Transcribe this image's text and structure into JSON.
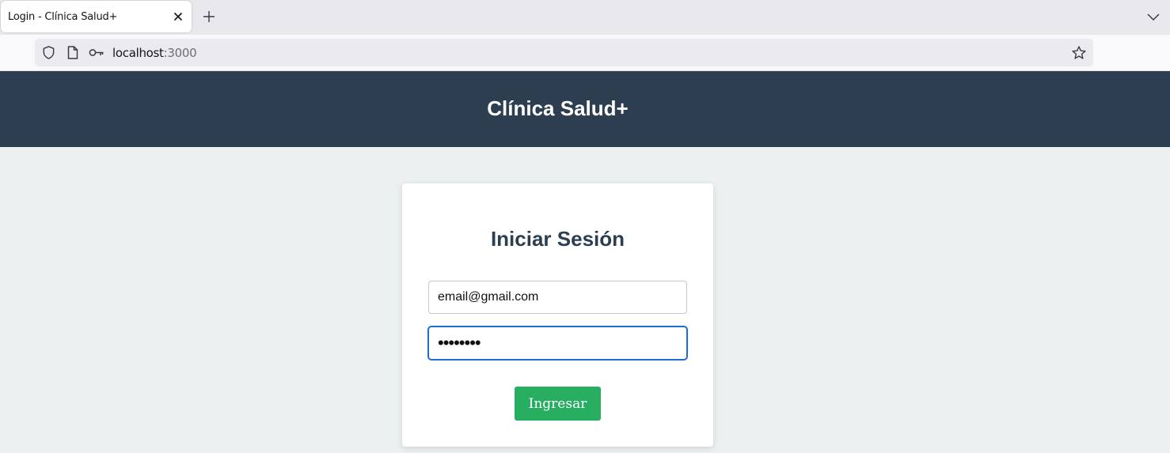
{
  "browser": {
    "tab_title": "Login - Clínica Salud+",
    "url_host": "localhost",
    "url_port": ":3000"
  },
  "header": {
    "title": "Clínica Salud+"
  },
  "login": {
    "title": "Iniciar Sesión",
    "email_value": "email@gmail.com",
    "password_mask": "••••••••",
    "submit_label": "Ingresar"
  },
  "colors": {
    "header_bg": "#2c3e50",
    "page_bg": "#ecf0f1",
    "button_bg": "#27ae60",
    "focus_border": "#1a6dd1"
  },
  "icons": [
    "close-icon",
    "plus-icon",
    "chevron-down-icon",
    "shield-icon",
    "page-icon",
    "key-icon",
    "star-icon"
  ]
}
